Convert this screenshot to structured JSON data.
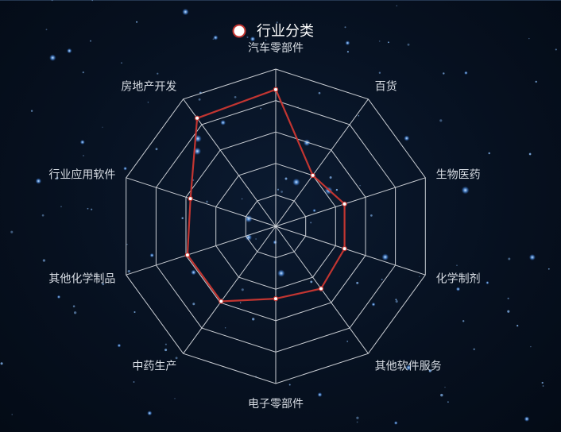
{
  "colors": {
    "background": "#06101f",
    "grid": "#c9cdd3",
    "series_line": "#c23531",
    "star": "#8fc3ff"
  },
  "chart_data": {
    "type": "radar",
    "legend": {
      "position": "top-center",
      "label": "行业分类",
      "marker": "circle-outline"
    },
    "indicators": [
      "汽车零部件",
      "百货",
      "生物医药",
      "化学制剂",
      "其他软件服务",
      "电子零部件",
      "中药生产",
      "其他化学制品",
      "行业应用软件",
      "房地产开发"
    ],
    "rings": 5,
    "max": 1,
    "series": [
      {
        "name": "行业分类",
        "values": [
          0.87,
          0.4,
          0.46,
          0.46,
          0.49,
          0.46,
          0.59,
          0.59,
          0.57,
          0.85
        ]
      }
    ]
  }
}
